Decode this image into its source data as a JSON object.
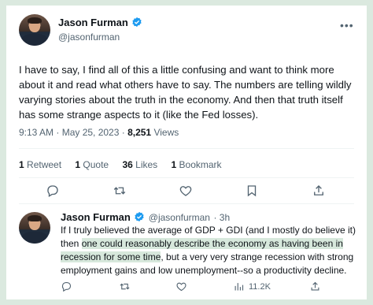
{
  "tweet": {
    "author_name": "Jason Furman",
    "author_handle": "@jasonfurman",
    "text": "I have to say, I find all of this a little confusing and want to think more about it and read what others have to say. The numbers are telling wildly varying stories about the truth in the economy. And then that truth itself has some strange aspects to it (like the Fed losses).",
    "time": "9:13 AM · May 25, 2023 · ",
    "views_count": "8,251",
    "views_label": " Views",
    "stats": {
      "retweets_count": "1",
      "retweets_label": " Retweet",
      "quotes_count": "1",
      "quotes_label": " Quote",
      "likes_count": "36",
      "likes_label": " Likes",
      "bookmarks_count": "1",
      "bookmarks_label": " Bookmark"
    }
  },
  "reply": {
    "author_name": "Jason Furman",
    "author_handle": "@jasonfurman",
    "age": "· 3h",
    "text_part1": "If I truly believed the average of GDP + GDI (and I mostly do believe it) then ",
    "text_highlight1": "one could reasonably describe the economy as having been in",
    "text_highlight2": "recession for some time",
    "text_part2": ", but a very very strange recession with strong employment gains and low unemployment--so a productivity decline.",
    "views": "11.2K"
  },
  "colors": {
    "background": "#dbe9df",
    "verified": "#1d9bf0",
    "highlight": "#d7e8dc",
    "secondary_text": "#536471"
  },
  "icons": [
    "verified-icon",
    "more-icon",
    "reply-icon",
    "retweet-icon",
    "like-icon",
    "bookmark-icon",
    "share-icon",
    "views-icon"
  ]
}
